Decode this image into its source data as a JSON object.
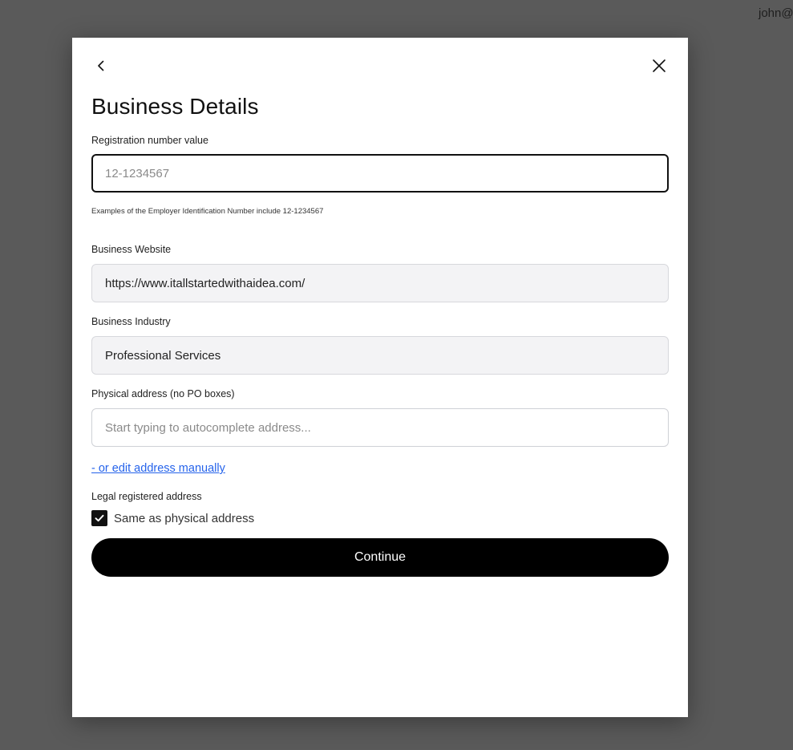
{
  "header": {
    "user_label": "john@"
  },
  "modal": {
    "title": "Business Details",
    "back_icon": "chevron-left-icon",
    "close_icon": "close-icon",
    "registration": {
      "label": "Registration number value",
      "value": "",
      "placeholder": "12-1234567",
      "helper": "Examples of the Employer Identification Number include 12-1234567"
    },
    "website": {
      "label": "Business Website",
      "value": "https://www.itallstartedwithaidea.com/"
    },
    "industry": {
      "label": "Business Industry",
      "value": "Professional Services"
    },
    "address": {
      "label": "Physical address (no PO boxes)",
      "value": "",
      "placeholder": "Start typing to autocomplete address..."
    },
    "manual_link": "- or edit address manually",
    "legal_address": {
      "label": "Legal registered address",
      "checkbox_label": "Same as physical address",
      "checked": true
    },
    "continue_label": "Continue"
  },
  "colors": {
    "overlay": "#5a5a5a",
    "primary_button": "#000000",
    "link": "#2563eb",
    "filled_input_bg": "#f3f3f5"
  }
}
